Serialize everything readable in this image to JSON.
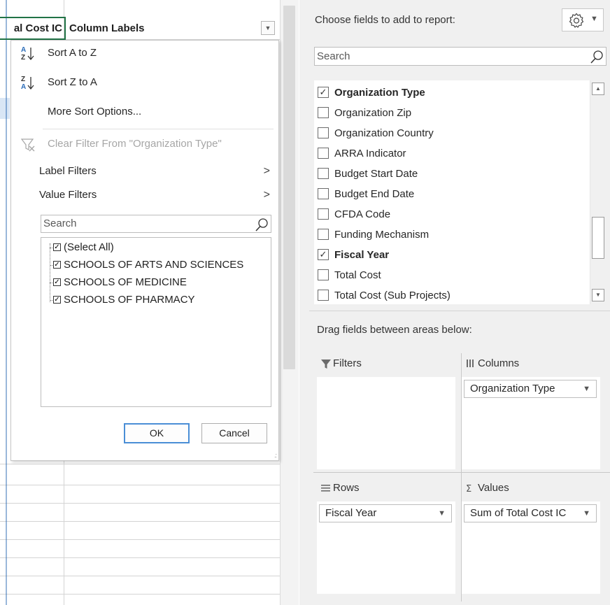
{
  "sheet": {
    "header_left": "al Cost IC",
    "header_right": "Column Labels"
  },
  "filter_menu": {
    "sort_az": "Sort A to Z",
    "sort_za": "Sort Z to A",
    "more_sort": "More Sort Options...",
    "clear_filter": "Clear Filter From \"Organization Type\"",
    "label_filters": "Label Filters",
    "value_filters": "Value Filters",
    "search_placeholder": "Search",
    "items": [
      {
        "label": "(Select All)",
        "checked": true
      },
      {
        "label": "SCHOOLS OF ARTS AND SCIENCES",
        "checked": true
      },
      {
        "label": "SCHOOLS OF MEDICINE",
        "checked": true
      },
      {
        "label": "SCHOOLS OF PHARMACY",
        "checked": true
      }
    ],
    "ok": "OK",
    "cancel": "Cancel"
  },
  "field_pane": {
    "title": "Choose fields to add to report:",
    "search_placeholder": "Search",
    "fields": [
      {
        "label": "Organization Type",
        "checked": true
      },
      {
        "label": "Organization Zip",
        "checked": false
      },
      {
        "label": "Organization Country",
        "checked": false
      },
      {
        "label": "ARRA Indicator",
        "checked": false
      },
      {
        "label": "Budget Start Date",
        "checked": false
      },
      {
        "label": "Budget End Date",
        "checked": false
      },
      {
        "label": "CFDA Code",
        "checked": false
      },
      {
        "label": "Funding Mechanism",
        "checked": false
      },
      {
        "label": "Fiscal Year",
        "checked": true
      },
      {
        "label": "Total Cost",
        "checked": false
      },
      {
        "label": "Total Cost (Sub Projects)",
        "checked": false
      }
    ],
    "drag_text": "Drag fields between areas below:",
    "areas": {
      "filters": {
        "title": "Filters",
        "item": ""
      },
      "columns": {
        "title": "Columns",
        "item": "Organization Type"
      },
      "rows": {
        "title": "Rows",
        "item": "Fiscal Year"
      },
      "values": {
        "title": "Values",
        "item": "Sum of Total Cost IC"
      }
    }
  },
  "icons": {
    "gear": "gear-icon",
    "search": "search-icon",
    "sort_az": "sort-ascending-icon",
    "sort_za": "sort-descending-icon",
    "clear_filter": "clear-filter-icon",
    "filters": "filter-funnel-icon",
    "columns": "columns-icon",
    "rows": "rows-icon",
    "values": "sigma-icon"
  },
  "colors": {
    "active_cell_border": "#217346",
    "ok_button_border": "#4a8ed6",
    "pane_background": "#f0f0f0"
  }
}
